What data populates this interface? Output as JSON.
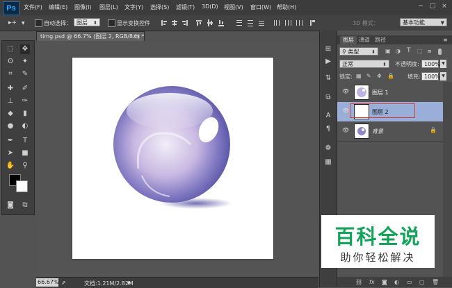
{
  "app": {
    "logo": "Ps"
  },
  "menu": [
    "文件(F)",
    "编辑(E)",
    "图像(I)",
    "图层(L)",
    "文字(Y)",
    "选择(S)",
    "滤镜(T)",
    "3D(D)",
    "视图(V)",
    "窗口(W)",
    "帮助(H)"
  ],
  "options": {
    "tool_glyph": "▸+",
    "auto_select_label": "自动选择：",
    "auto_select_value": "图层",
    "show_transform_label": "显示变换控件",
    "mode_label": "3D 模式：",
    "workspace": "基本功能"
  },
  "document": {
    "tab_title": "timg.psd @ 66.7% (图层 2, RGB/8#) *",
    "tab_close": "×",
    "zoom": "66.67%",
    "doc_info": "文档:1.21M/2.82M"
  },
  "layers_panel": {
    "tabs": [
      "图层",
      "通道",
      "路径"
    ],
    "filter_kind": "类型",
    "blend_mode": "正常",
    "opacity_label": "不透明度:",
    "opacity_value": "100%",
    "lock_label": "锁定:",
    "fill_label": "填充:",
    "fill_value": "100%",
    "layers": [
      {
        "name": "图层 1",
        "visible": true,
        "selected": false
      },
      {
        "name": "图层 2",
        "visible": true,
        "selected": true
      },
      {
        "name": "背景",
        "visible": true,
        "selected": false,
        "locked": true
      }
    ]
  },
  "watermark": {
    "title": "百科全说",
    "subtitle": "助你轻松解决"
  },
  "colors": {
    "selected_layer": "#99afd8",
    "watermark_green": "#13a45a",
    "accent": "#31a8ff"
  }
}
